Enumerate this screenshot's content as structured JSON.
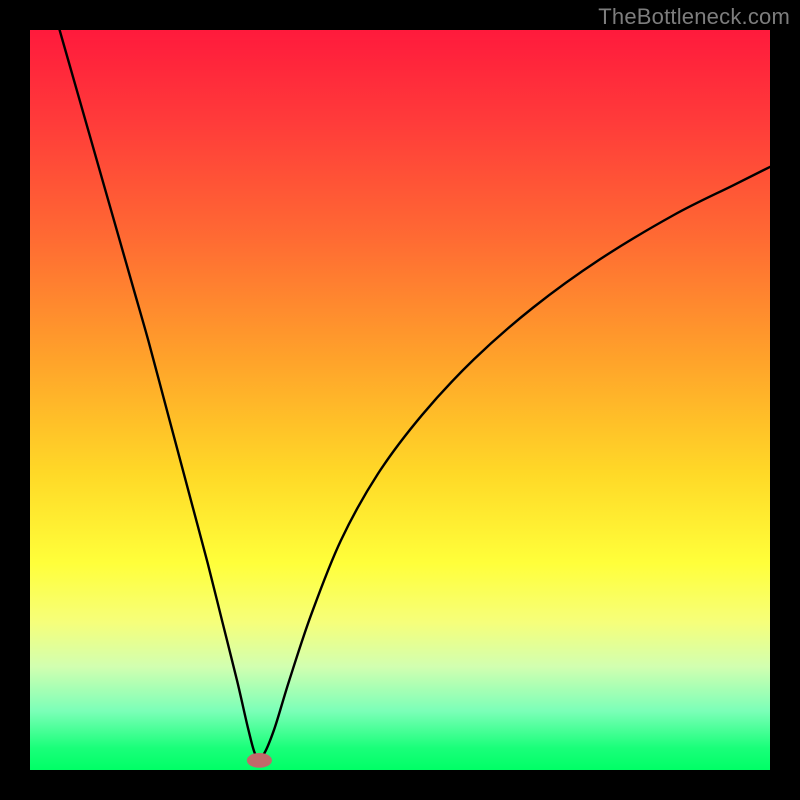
{
  "watermark": {
    "text": "TheBottleneck.com"
  },
  "chart_data": {
    "type": "line",
    "title": "",
    "xlabel": "",
    "ylabel": "",
    "xlim": [
      0,
      1
    ],
    "ylim": [
      0,
      1
    ],
    "note": "V-shaped bottleneck curve over a vertical red→green gradient. The V's cusp is at roughly x≈0.31, y≈0.02. The left branch rises steeply to the top-left corner (x≈0.04, y=1.0); the right branch rises with slight decreasing slope toward the right edge (x=1.0, y≈0.81). Values are normalized to [0,1] within the plot area; axes are not labeled so units are unknown.",
    "series": [
      {
        "name": "curve",
        "x": [
          0.04,
          0.06,
          0.08,
          0.1,
          0.12,
          0.14,
          0.16,
          0.18,
          0.2,
          0.22,
          0.24,
          0.26,
          0.28,
          0.295,
          0.305,
          0.315,
          0.33,
          0.35,
          0.38,
          0.42,
          0.47,
          0.53,
          0.6,
          0.68,
          0.77,
          0.87,
          0.95,
          1.0
        ],
        "y": [
          1.0,
          0.93,
          0.86,
          0.79,
          0.72,
          0.65,
          0.58,
          0.505,
          0.43,
          0.355,
          0.28,
          0.2,
          0.12,
          0.055,
          0.02,
          0.02,
          0.055,
          0.12,
          0.21,
          0.31,
          0.4,
          0.48,
          0.555,
          0.625,
          0.69,
          0.75,
          0.79,
          0.815
        ]
      }
    ],
    "marker": {
      "x": 0.31,
      "y": 0.013,
      "rx": 0.017,
      "ry": 0.01,
      "color": "#c06a6a"
    },
    "gradient_stops": [
      {
        "pos": 0.0,
        "color": "#ff1a3c"
      },
      {
        "pos": 0.5,
        "color": "#ffd927"
      },
      {
        "pos": 0.8,
        "color": "#f6ff7a"
      },
      {
        "pos": 1.0,
        "color": "#00ff66"
      }
    ]
  }
}
